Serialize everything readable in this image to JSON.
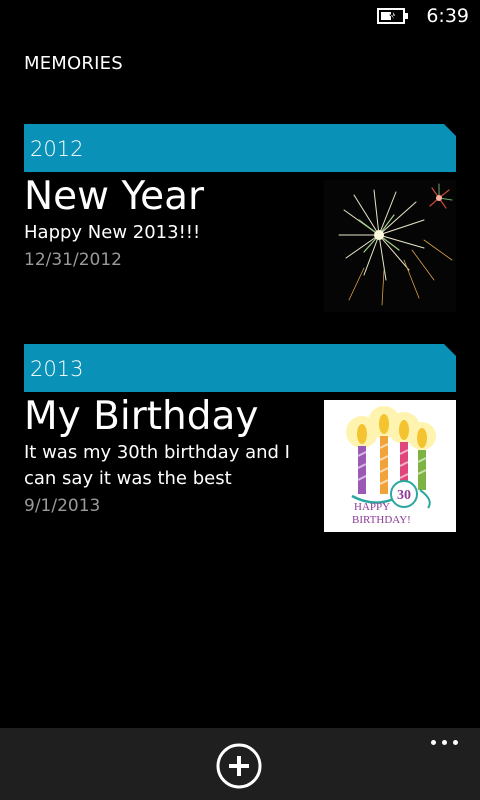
{
  "status_bar": {
    "time": "6:39",
    "battery_icon": "battery-charging-icon"
  },
  "app": {
    "title": "MEMORIES"
  },
  "groups": [
    {
      "year": "2012",
      "items": [
        {
          "title": "New Year",
          "description": "Happy New 2013!!!",
          "date": "12/31/2012",
          "image": "fireworks-image"
        }
      ]
    },
    {
      "year": "2013",
      "items": [
        {
          "title": "My Birthday",
          "description": "It was my 30th birthday and I can say it was the best",
          "date": "9/1/2013",
          "image": "birthday-candles-image",
          "image_number": "30",
          "image_text_1": "HAPPY",
          "image_text_2": "BIRTHDAY!"
        }
      ]
    }
  ],
  "app_bar": {
    "add_icon": "add-circle-icon",
    "more_icon": "more-dots-icon"
  },
  "colors": {
    "accent": "#0a91b8",
    "background": "#000000",
    "app_bar": "#1f1f1f",
    "secondary_text": "#9a9a9a"
  }
}
